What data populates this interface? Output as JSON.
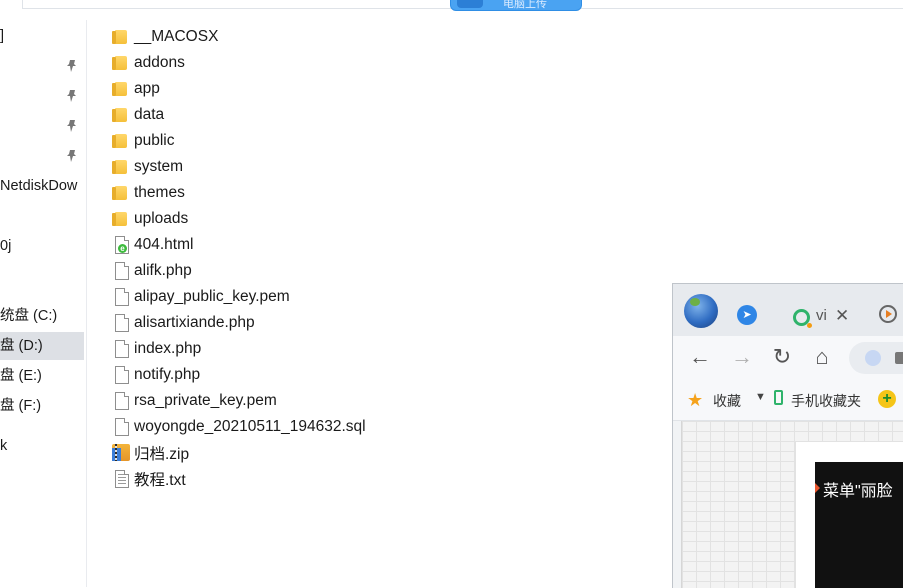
{
  "top": {
    "button_label": "电脑上传"
  },
  "nav": {
    "items": [
      {
        "label": "]",
        "pinned": false
      },
      {
        "label": "",
        "pinned": true
      },
      {
        "label": "",
        "pinned": true
      },
      {
        "label": "",
        "pinned": true
      },
      {
        "label": "",
        "pinned": true
      },
      {
        "label": "NetdiskDow",
        "pinned": false
      },
      {
        "label": "0j",
        "pinned": false
      },
      {
        "label": "统盘 (C:)",
        "pinned": false
      },
      {
        "label": "盘 (D:)",
        "pinned": false,
        "selected": true
      },
      {
        "label": "盘 (E:)",
        "pinned": false
      },
      {
        "label": "盘 (F:)",
        "pinned": false
      },
      {
        "label": "k",
        "pinned": false
      }
    ]
  },
  "files": [
    {
      "name": "__MACOSX",
      "type": "folder"
    },
    {
      "name": "addons",
      "type": "folder"
    },
    {
      "name": "app",
      "type": "folder"
    },
    {
      "name": "data",
      "type": "folder"
    },
    {
      "name": "public",
      "type": "folder"
    },
    {
      "name": "system",
      "type": "folder"
    },
    {
      "name": "themes",
      "type": "folder"
    },
    {
      "name": "uploads",
      "type": "folder"
    },
    {
      "name": "404.html",
      "type": "html"
    },
    {
      "name": "alifk.php",
      "type": "file"
    },
    {
      "name": "alipay_public_key.pem",
      "type": "file"
    },
    {
      "name": "alisartixiande.php",
      "type": "file"
    },
    {
      "name": "index.php",
      "type": "file"
    },
    {
      "name": "notify.php",
      "type": "file"
    },
    {
      "name": "rsa_private_key.pem",
      "type": "file"
    },
    {
      "name": "woyongde_20210511_194632.sql",
      "type": "file"
    },
    {
      "name": "归档.zip",
      "type": "zip"
    },
    {
      "name": "教程.txt",
      "type": "txt"
    }
  ],
  "browser": {
    "tab_title": "vi",
    "tab_close": "✕",
    "toolbar": {
      "back": "←",
      "forward": "→",
      "reload": "↻",
      "home": "⌂"
    },
    "bookmarks": {
      "favorites": "收藏",
      "caret": "▼",
      "mobile": "手机收藏夹",
      "plus": "+"
    },
    "video_title": "菜单\"丽脸"
  },
  "colors": {
    "accent": "#4aa3f2",
    "folder": "#f5c03a",
    "selected_nav": "#dde0e5"
  }
}
